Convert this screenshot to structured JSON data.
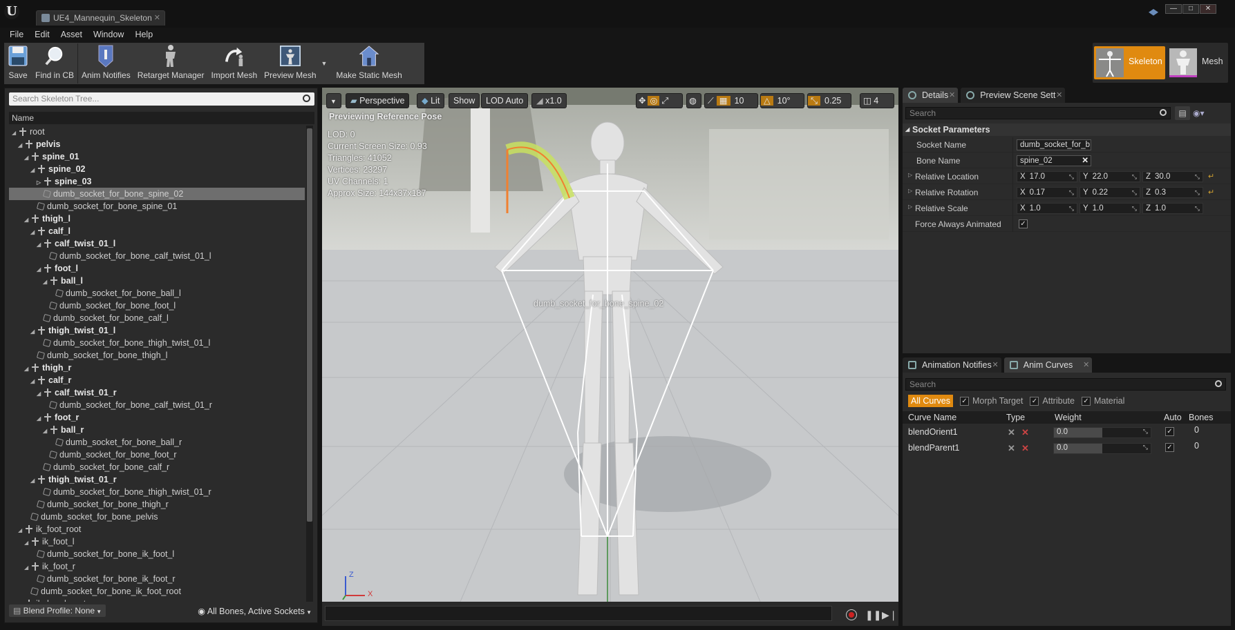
{
  "window": {
    "doc_tab": "UE4_Mannequin_Skeleton",
    "minimize": "—",
    "maximize": "□",
    "close": "✕"
  },
  "menu": [
    "File",
    "Edit",
    "Asset",
    "Window",
    "Help"
  ],
  "toolbar": {
    "save": "Save",
    "find_in_cb": "Find in CB",
    "anim_notifies": "Anim Notifies",
    "retarget_manager": "Retarget Manager",
    "import_mesh": "Import Mesh",
    "preview_mesh": "Preview Mesh",
    "make_static_mesh": "Make Static Mesh"
  },
  "modes": {
    "skeleton": "Skeleton",
    "mesh": "Mesh"
  },
  "skeleton_tree": {
    "search_placeholder": "Search Skeleton Tree...",
    "column": "Name",
    "rows": [
      {
        "label": "root",
        "indent": 0,
        "kind": "bone",
        "arrow": "◢",
        "bold": false
      },
      {
        "label": "pelvis",
        "indent": 1,
        "kind": "bone",
        "arrow": "◢",
        "bold": true
      },
      {
        "label": "spine_01",
        "indent": 2,
        "kind": "bone",
        "arrow": "◢",
        "bold": true
      },
      {
        "label": "spine_02",
        "indent": 3,
        "kind": "bone",
        "arrow": "◢",
        "bold": true
      },
      {
        "label": "spine_03",
        "indent": 4,
        "kind": "bone",
        "arrow": "▷",
        "bold": true
      },
      {
        "label": "dumb_socket_for_bone_spine_02",
        "indent": 4,
        "kind": "socket",
        "arrow": "",
        "bold": false,
        "selected": true
      },
      {
        "label": "dumb_socket_for_bone_spine_01",
        "indent": 3,
        "kind": "socket",
        "arrow": "",
        "bold": false
      },
      {
        "label": "thigh_l",
        "indent": 2,
        "kind": "bone",
        "arrow": "◢",
        "bold": true
      },
      {
        "label": "calf_l",
        "indent": 3,
        "kind": "bone",
        "arrow": "◢",
        "bold": true
      },
      {
        "label": "calf_twist_01_l",
        "indent": 4,
        "kind": "bone",
        "arrow": "◢",
        "bold": true
      },
      {
        "label": "dumb_socket_for_bone_calf_twist_01_l",
        "indent": 5,
        "kind": "socket",
        "arrow": "",
        "bold": false
      },
      {
        "label": "foot_l",
        "indent": 4,
        "kind": "bone",
        "arrow": "◢",
        "bold": true
      },
      {
        "label": "ball_l",
        "indent": 5,
        "kind": "bone",
        "arrow": "◢",
        "bold": true
      },
      {
        "label": "dumb_socket_for_bone_ball_l",
        "indent": 6,
        "kind": "socket",
        "arrow": "",
        "bold": false
      },
      {
        "label": "dumb_socket_for_bone_foot_l",
        "indent": 5,
        "kind": "socket",
        "arrow": "",
        "bold": false
      },
      {
        "label": "dumb_socket_for_bone_calf_l",
        "indent": 4,
        "kind": "socket",
        "arrow": "",
        "bold": false
      },
      {
        "label": "thigh_twist_01_l",
        "indent": 3,
        "kind": "bone",
        "arrow": "◢",
        "bold": true
      },
      {
        "label": "dumb_socket_for_bone_thigh_twist_01_l",
        "indent": 4,
        "kind": "socket",
        "arrow": "",
        "bold": false
      },
      {
        "label": "dumb_socket_for_bone_thigh_l",
        "indent": 3,
        "kind": "socket",
        "arrow": "",
        "bold": false
      },
      {
        "label": "thigh_r",
        "indent": 2,
        "kind": "bone",
        "arrow": "◢",
        "bold": true
      },
      {
        "label": "calf_r",
        "indent": 3,
        "kind": "bone",
        "arrow": "◢",
        "bold": true
      },
      {
        "label": "calf_twist_01_r",
        "indent": 4,
        "kind": "bone",
        "arrow": "◢",
        "bold": true
      },
      {
        "label": "dumb_socket_for_bone_calf_twist_01_r",
        "indent": 5,
        "kind": "socket",
        "arrow": "",
        "bold": false
      },
      {
        "label": "foot_r",
        "indent": 4,
        "kind": "bone",
        "arrow": "◢",
        "bold": true
      },
      {
        "label": "ball_r",
        "indent": 5,
        "kind": "bone",
        "arrow": "◢",
        "bold": true
      },
      {
        "label": "dumb_socket_for_bone_ball_r",
        "indent": 6,
        "kind": "socket",
        "arrow": "",
        "bold": false
      },
      {
        "label": "dumb_socket_for_bone_foot_r",
        "indent": 5,
        "kind": "socket",
        "arrow": "",
        "bold": false
      },
      {
        "label": "dumb_socket_for_bone_calf_r",
        "indent": 4,
        "kind": "socket",
        "arrow": "",
        "bold": false
      },
      {
        "label": "thigh_twist_01_r",
        "indent": 3,
        "kind": "bone",
        "arrow": "◢",
        "bold": true
      },
      {
        "label": "dumb_socket_for_bone_thigh_twist_01_r",
        "indent": 4,
        "kind": "socket",
        "arrow": "",
        "bold": false
      },
      {
        "label": "dumb_socket_for_bone_thigh_r",
        "indent": 3,
        "kind": "socket",
        "arrow": "",
        "bold": false
      },
      {
        "label": "dumb_socket_for_bone_pelvis",
        "indent": 2,
        "kind": "socket",
        "arrow": "",
        "bold": false
      },
      {
        "label": "ik_foot_root",
        "indent": 1,
        "kind": "bone",
        "arrow": "◢",
        "bold": false
      },
      {
        "label": "ik_foot_l",
        "indent": 2,
        "kind": "bone",
        "arrow": "◢",
        "bold": false
      },
      {
        "label": "dumb_socket_for_bone_ik_foot_l",
        "indent": 3,
        "kind": "socket",
        "arrow": "",
        "bold": false
      },
      {
        "label": "ik_foot_r",
        "indent": 2,
        "kind": "bone",
        "arrow": "◢",
        "bold": false
      },
      {
        "label": "dumb_socket_for_bone_ik_foot_r",
        "indent": 3,
        "kind": "socket",
        "arrow": "",
        "bold": false
      },
      {
        "label": "dumb_socket_for_bone_ik_foot_root",
        "indent": 2,
        "kind": "socket",
        "arrow": "",
        "bold": false
      },
      {
        "label": "ik_hand_root",
        "indent": 1,
        "kind": "bone",
        "arrow": "◢",
        "bold": false
      }
    ],
    "blend_profile": "Blend Profile: None",
    "bones_filter": "All Bones, Active Sockets"
  },
  "viewport": {
    "perspective": "Perspective",
    "lit": "Lit",
    "show": "Show",
    "lod": "LOD Auto",
    "speed": "x1.0",
    "grid_size": "10",
    "rot_snap": "10°",
    "scale_snap": "0.25",
    "cam_speed": "4",
    "previewing": "Previewing Reference Pose",
    "stats": [
      "LOD: 0",
      "Current Screen Size: 0.93",
      "Triangles: 41052",
      "Vertices: 23297",
      "UV Channels: 1",
      "Approx Size: 144x37x187"
    ],
    "socket_label": "dumb_socket_for_bone_spine_02",
    "axis_x": "X",
    "axis_z": "Z"
  },
  "details": {
    "tab_details": "Details",
    "tab_preview": "Preview Scene Sett",
    "search_placeholder": "Search",
    "section": "Socket Parameters",
    "socket_name_label": "Socket Name",
    "socket_name_value": "dumb_socket_for_b",
    "bone_name_label": "Bone Name",
    "bone_name_value": "spine_02",
    "rel_location_label": "Relative Location",
    "rel_location": {
      "x": "17.0",
      "y": "22.0",
      "z": "30.0"
    },
    "rel_rotation_label": "Relative Rotation",
    "rel_rotation": {
      "x": "0.17",
      "y": "0.22",
      "z": "0.3"
    },
    "rel_scale_label": "Relative Scale",
    "rel_scale": {
      "x": "1.0",
      "y": "1.0",
      "z": "1.0"
    },
    "force_animated_label": "Force Always Animated",
    "force_animated_checked": true
  },
  "anim_curves": {
    "tab_notifies": "Animation Notifies",
    "tab_curves": "Anim Curves",
    "search_placeholder": "Search",
    "filter_all": "All Curves",
    "filter_morph": "Morph Target",
    "filter_attribute": "Attribute",
    "filter_material": "Material",
    "col_name": "Curve Name",
    "col_type": "Type",
    "col_weight": "Weight",
    "col_auto": "Auto",
    "col_bones": "Bones",
    "rows": [
      {
        "name": "blendOrient1",
        "weight": "0.0",
        "bones": "0"
      },
      {
        "name": "blendParent1",
        "weight": "0.0",
        "bones": "0"
      }
    ]
  },
  "colors": {
    "accent": "#e08a10",
    "panel": "#2b2b2b",
    "selection": "#6e6e6e"
  }
}
